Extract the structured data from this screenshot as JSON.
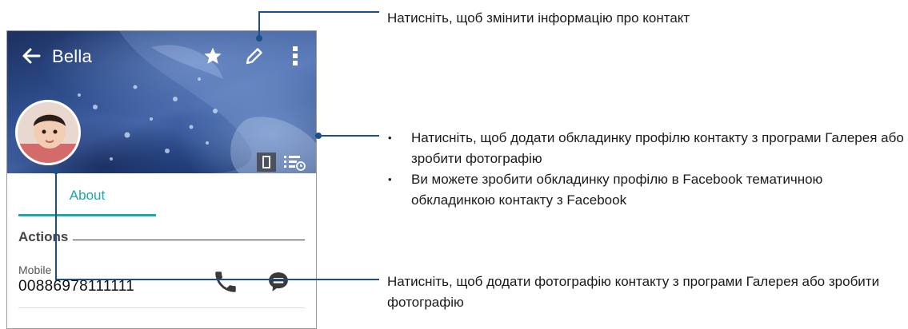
{
  "app_bar": {
    "contact_name": "Bella",
    "icons": [
      "back-arrow-icon",
      "star-icon",
      "pencil-icon",
      "more-vert-icon"
    ]
  },
  "tabs": [
    {
      "label": "About",
      "selected": true
    }
  ],
  "actions": {
    "header": "Actions",
    "phone": {
      "type_label": "Mobile",
      "number": "00886978111111"
    }
  },
  "callouts": {
    "edit_info": "Натисніть, щоб змінити інформацію про контакт",
    "cover_bullets": [
      "Натисніть, щоб додати обкладинку профілю контакту з програми Галерея або зробити фотографію",
      "Ви можете зробити обкладинку профілю в Facebook тематичною обкладинкою контакту з Facebook"
    ],
    "photo": "Натисніть, щоб додати фотографію контакту з програми Галерея або зробити фотографію"
  },
  "colors": {
    "accent": "#1aa8a8",
    "callout_line": "#1c4e8a",
    "cover_blue": "#2f4f8e"
  }
}
